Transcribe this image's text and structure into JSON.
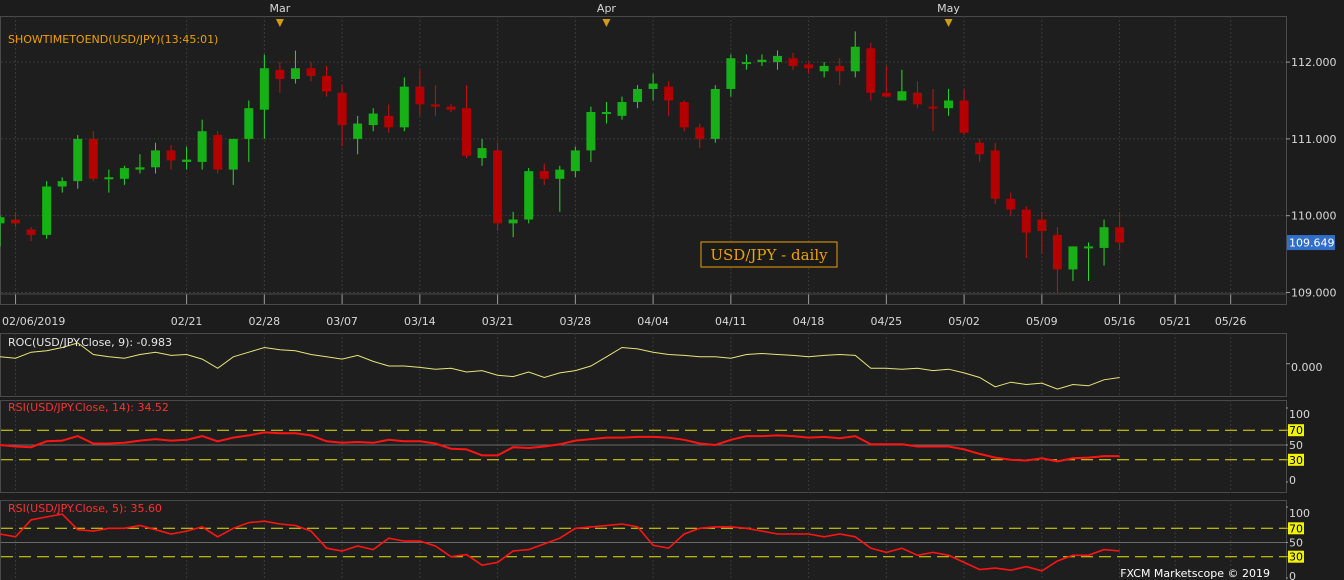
{
  "chart_data": [
    {
      "type": "candlestick",
      "instrument_label": "SHOWTIMETOEND(USD/JPY)(13:45:01)",
      "watermark": "USD/JPY - daily",
      "last_price_label": "109.649",
      "ylim": [
        108.85,
        112.6
      ],
      "yticks": [
        {
          "value": 109.0,
          "label": "109.000"
        },
        {
          "value": 110.0,
          "label": "110.000"
        },
        {
          "value": 111.0,
          "label": "111.000"
        },
        {
          "value": 112.0,
          "label": "112.000"
        }
      ],
      "month_markers": [
        {
          "label": "Mar",
          "date": "03/01"
        },
        {
          "label": "Apr",
          "date": "04/01"
        },
        {
          "label": "May",
          "date": "05/01"
        }
      ],
      "x_ticks": [
        "02/06/2019",
        "02/21",
        "02/28",
        "03/07",
        "03/14",
        "03/21",
        "03/28",
        "04/04",
        "04/11",
        "04/18",
        "04/25",
        "05/02",
        "05/09",
        "05/16",
        "05/21",
        "05/26"
      ],
      "candles": [
        {
          "date": "02/05",
          "o": 109.9,
          "h": 110.0,
          "l": 109.6,
          "c": 109.98
        },
        {
          "date": "02/06",
          "o": 109.95,
          "h": 110.05,
          "l": 109.85,
          "c": 109.9
        },
        {
          "date": "02/07",
          "o": 109.82,
          "h": 109.85,
          "l": 109.67,
          "c": 109.75
        },
        {
          "date": "02/08",
          "o": 109.75,
          "h": 110.45,
          "l": 109.7,
          "c": 110.38
        },
        {
          "date": "02/11",
          "o": 110.38,
          "h": 110.5,
          "l": 110.3,
          "c": 110.45
        },
        {
          "date": "02/12",
          "o": 110.45,
          "h": 111.05,
          "l": 110.35,
          "c": 111.0
        },
        {
          "date": "02/13",
          "o": 111.0,
          "h": 111.1,
          "l": 110.45,
          "c": 110.48
        },
        {
          "date": "02/14",
          "o": 110.48,
          "h": 110.6,
          "l": 110.3,
          "c": 110.5
        },
        {
          "date": "02/15",
          "o": 110.48,
          "h": 110.65,
          "l": 110.4,
          "c": 110.62
        },
        {
          "date": "02/18",
          "o": 110.6,
          "h": 110.8,
          "l": 110.55,
          "c": 110.63
        },
        {
          "date": "02/19",
          "o": 110.63,
          "h": 110.95,
          "l": 110.55,
          "c": 110.85
        },
        {
          "date": "02/20",
          "o": 110.85,
          "h": 110.92,
          "l": 110.6,
          "c": 110.72
        },
        {
          "date": "02/21",
          "o": 110.7,
          "h": 110.9,
          "l": 110.6,
          "c": 110.73
        },
        {
          "date": "02/22",
          "o": 110.7,
          "h": 111.25,
          "l": 110.6,
          "c": 111.1
        },
        {
          "date": "02/25",
          "o": 111.05,
          "h": 111.1,
          "l": 110.55,
          "c": 110.6
        },
        {
          "date": "02/26",
          "o": 110.6,
          "h": 111.0,
          "l": 110.4,
          "c": 111.0
        },
        {
          "date": "02/27",
          "o": 111.0,
          "h": 111.5,
          "l": 110.7,
          "c": 111.4
        },
        {
          "date": "02/28",
          "o": 111.38,
          "h": 112.1,
          "l": 111.0,
          "c": 111.92
        },
        {
          "date": "03/01",
          "o": 111.9,
          "h": 112.0,
          "l": 111.6,
          "c": 111.78
        },
        {
          "date": "03/04",
          "o": 111.78,
          "h": 112.15,
          "l": 111.72,
          "c": 111.92
        },
        {
          "date": "03/05",
          "o": 111.92,
          "h": 112.0,
          "l": 111.75,
          "c": 111.82
        },
        {
          "date": "03/06",
          "o": 111.82,
          "h": 111.95,
          "l": 111.55,
          "c": 111.62
        },
        {
          "date": "03/07",
          "o": 111.6,
          "h": 111.7,
          "l": 110.9,
          "c": 111.18
        },
        {
          "date": "03/08",
          "o": 111.0,
          "h": 111.3,
          "l": 110.8,
          "c": 111.2
        },
        {
          "date": "03/11",
          "o": 111.18,
          "h": 111.4,
          "l": 111.1,
          "c": 111.33
        },
        {
          "date": "03/12",
          "o": 111.3,
          "h": 111.45,
          "l": 111.08,
          "c": 111.15
        },
        {
          "date": "03/13",
          "o": 111.15,
          "h": 111.8,
          "l": 111.1,
          "c": 111.68
        },
        {
          "date": "03/14",
          "o": 111.68,
          "h": 111.9,
          "l": 111.3,
          "c": 111.45
        },
        {
          "date": "03/15",
          "o": 111.45,
          "h": 111.7,
          "l": 111.3,
          "c": 111.42
        },
        {
          "date": "03/18",
          "o": 111.42,
          "h": 111.45,
          "l": 111.35,
          "c": 111.38
        },
        {
          "date": "03/19",
          "o": 111.4,
          "h": 111.7,
          "l": 110.75,
          "c": 110.78
        },
        {
          "date": "03/20",
          "o": 110.75,
          "h": 111.0,
          "l": 110.65,
          "c": 110.88
        },
        {
          "date": "03/21",
          "o": 110.85,
          "h": 110.95,
          "l": 109.8,
          "c": 109.9
        },
        {
          "date": "03/22",
          "o": 109.9,
          "h": 110.05,
          "l": 109.72,
          "c": 109.95
        },
        {
          "date": "03/25",
          "o": 109.95,
          "h": 110.62,
          "l": 109.9,
          "c": 110.58
        },
        {
          "date": "03/26",
          "o": 110.58,
          "h": 110.68,
          "l": 110.4,
          "c": 110.48
        },
        {
          "date": "03/27",
          "o": 110.48,
          "h": 110.65,
          "l": 110.05,
          "c": 110.6
        },
        {
          "date": "03/28",
          "o": 110.58,
          "h": 110.9,
          "l": 110.5,
          "c": 110.85
        },
        {
          "date": "03/29",
          "o": 110.85,
          "h": 111.42,
          "l": 110.7,
          "c": 111.35
        },
        {
          "date": "04/01",
          "o": 111.35,
          "h": 111.48,
          "l": 111.2,
          "c": 111.35
        },
        {
          "date": "04/02",
          "o": 111.3,
          "h": 111.55,
          "l": 111.25,
          "c": 111.48
        },
        {
          "date": "04/03",
          "o": 111.48,
          "h": 111.7,
          "l": 111.4,
          "c": 111.65
        },
        {
          "date": "04/04",
          "o": 111.65,
          "h": 111.85,
          "l": 111.5,
          "c": 111.72
        },
        {
          "date": "04/05",
          "o": 111.68,
          "h": 111.75,
          "l": 111.3,
          "c": 111.5
        },
        {
          "date": "04/08",
          "o": 111.48,
          "h": 111.5,
          "l": 111.1,
          "c": 111.15
        },
        {
          "date": "04/09",
          "o": 111.15,
          "h": 111.2,
          "l": 110.88,
          "c": 111.0
        },
        {
          "date": "04/10",
          "o": 111.0,
          "h": 111.7,
          "l": 110.95,
          "c": 111.65
        },
        {
          "date": "04/11",
          "o": 111.65,
          "h": 112.1,
          "l": 111.55,
          "c": 112.05
        },
        {
          "date": "04/12",
          "o": 112.0,
          "h": 112.1,
          "l": 111.9,
          "c": 112.0
        },
        {
          "date": "04/15",
          "o": 112.0,
          "h": 112.1,
          "l": 111.95,
          "c": 112.03
        },
        {
          "date": "04/16",
          "o": 112.0,
          "h": 112.15,
          "l": 111.9,
          "c": 112.08
        },
        {
          "date": "04/17",
          "o": 112.05,
          "h": 112.12,
          "l": 111.9,
          "c": 111.95
        },
        {
          "date": "04/18",
          "o": 111.97,
          "h": 112.0,
          "l": 111.85,
          "c": 111.92
        },
        {
          "date": "04/19",
          "o": 111.88,
          "h": 112.0,
          "l": 111.8,
          "c": 111.95
        },
        {
          "date": "04/22",
          "o": 111.95,
          "h": 112.05,
          "l": 111.7,
          "c": 111.88
        },
        {
          "date": "04/23",
          "o": 111.88,
          "h": 112.4,
          "l": 111.8,
          "c": 112.2
        },
        {
          "date": "04/24",
          "o": 112.18,
          "h": 112.25,
          "l": 111.5,
          "c": 111.6
        },
        {
          "date": "04/25",
          "o": 111.6,
          "h": 111.95,
          "l": 111.55,
          "c": 111.55
        },
        {
          "date": "04/26",
          "o": 111.5,
          "h": 111.9,
          "l": 111.5,
          "c": 111.62
        },
        {
          "date": "04/29",
          "o": 111.6,
          "h": 111.75,
          "l": 111.4,
          "c": 111.45
        },
        {
          "date": "04/30",
          "o": 111.42,
          "h": 111.65,
          "l": 111.1,
          "c": 111.4
        },
        {
          "date": "05/01",
          "o": 111.4,
          "h": 111.65,
          "l": 111.3,
          "c": 111.5
        },
        {
          "date": "05/02",
          "o": 111.5,
          "h": 111.65,
          "l": 111.05,
          "c": 111.08
        },
        {
          "date": "05/03",
          "o": 110.95,
          "h": 111.0,
          "l": 110.7,
          "c": 110.8
        },
        {
          "date": "05/06",
          "o": 110.85,
          "h": 110.95,
          "l": 110.15,
          "c": 110.22
        },
        {
          "date": "05/07",
          "o": 110.22,
          "h": 110.3,
          "l": 110.0,
          "c": 110.08
        },
        {
          "date": "05/08",
          "o": 110.08,
          "h": 110.12,
          "l": 109.45,
          "c": 109.78
        },
        {
          "date": "05/09",
          "o": 109.95,
          "h": 110.05,
          "l": 109.5,
          "c": 109.8
        },
        {
          "date": "05/10",
          "o": 109.75,
          "h": 109.85,
          "l": 109.0,
          "c": 109.3
        },
        {
          "date": "05/13",
          "o": 109.3,
          "h": 109.6,
          "l": 109.15,
          "c": 109.6
        },
        {
          "date": "05/14",
          "o": 109.6,
          "h": 109.65,
          "l": 109.15,
          "c": 109.6
        },
        {
          "date": "05/15",
          "o": 109.58,
          "h": 109.95,
          "l": 109.35,
          "c": 109.85
        },
        {
          "date": "05/16",
          "o": 109.85,
          "h": 110.05,
          "l": 109.55,
          "c": 109.65
        }
      ]
    },
    {
      "type": "line",
      "label": "ROC(USD/JPY.Close, 9): -0.983",
      "ytick": "0.000",
      "values": [
        0.15,
        0.12,
        0.25,
        0.28,
        0.35,
        0.45,
        0.2,
        0.15,
        0.12,
        0.2,
        0.25,
        0.18,
        0.2,
        0.1,
        -0.1,
        0.15,
        0.25,
        0.35,
        0.3,
        0.28,
        0.2,
        0.15,
        0.1,
        0.18,
        0.05,
        -0.05,
        -0.05,
        -0.08,
        -0.12,
        -0.1,
        -0.18,
        -0.15,
        -0.25,
        -0.28,
        -0.18,
        -0.3,
        -0.2,
        -0.15,
        -0.05,
        0.15,
        0.35,
        0.32,
        0.25,
        0.2,
        0.18,
        0.15,
        0.15,
        0.12,
        0.2,
        0.22,
        0.2,
        0.18,
        0.15,
        0.18,
        0.2,
        0.18,
        -0.1,
        -0.1,
        -0.12,
        -0.1,
        -0.15,
        -0.12,
        -0.2,
        -0.3,
        -0.5,
        -0.4,
        -0.45,
        -0.42,
        -0.55,
        -0.45,
        -0.48,
        -0.35,
        -0.3
      ]
    },
    {
      "type": "line",
      "label": "RSI(USD/JPY.Close, 14): 34.52",
      "ylim": [
        0,
        100
      ],
      "levels": [
        "100",
        "70",
        "50",
        "30",
        "0"
      ],
      "values": [
        50,
        48,
        47,
        55,
        56,
        62,
        52,
        52,
        53,
        56,
        58,
        56,
        57,
        62,
        55,
        60,
        63,
        67,
        66,
        66,
        63,
        55,
        53,
        54,
        53,
        57,
        55,
        55,
        52,
        45,
        44,
        36,
        36,
        47,
        46,
        48,
        51,
        56,
        58,
        60,
        60,
        61,
        61,
        60,
        57,
        52,
        50,
        57,
        62,
        62,
        63,
        62,
        60,
        61,
        59,
        62,
        51,
        51,
        51,
        48,
        48,
        48,
        44,
        38,
        33,
        30,
        29,
        32,
        28,
        32,
        33,
        35,
        35
      ]
    },
    {
      "type": "line",
      "label": "RSI(USD/JPY.Close, 5): 35.60",
      "ylim": [
        0,
        100
      ],
      "levels": [
        "100",
        "70",
        "50",
        "30",
        "0"
      ],
      "values": [
        62,
        58,
        82,
        86,
        90,
        68,
        66,
        70,
        70,
        74,
        68,
        62,
        66,
        72,
        58,
        70,
        78,
        80,
        76,
        74,
        66,
        42,
        38,
        45,
        40,
        56,
        52,
        52,
        45,
        30,
        33,
        18,
        22,
        38,
        40,
        48,
        56,
        70,
        72,
        74,
        76,
        72,
        46,
        42,
        62,
        70,
        72,
        72,
        70,
        66,
        62,
        62,
        62,
        58,
        62,
        58,
        42,
        36,
        42,
        32,
        36,
        32,
        22,
        12,
        14,
        11,
        16,
        10,
        24,
        32,
        32,
        40,
        38
      ]
    }
  ],
  "footer": {
    "credit": "FXCM Marketscope © 2019"
  },
  "colors": {
    "background": "#1c1c1c",
    "grid": "#3a3a3a",
    "up": "#17b017",
    "down": "#b50000",
    "roc_line": "#e6e67a",
    "rsi_line": "#ff1414",
    "level_line": "#e6e600",
    "label_orange": "#f0a000",
    "label_red": "#ff3030",
    "price_box": "#2f6fc9"
  }
}
